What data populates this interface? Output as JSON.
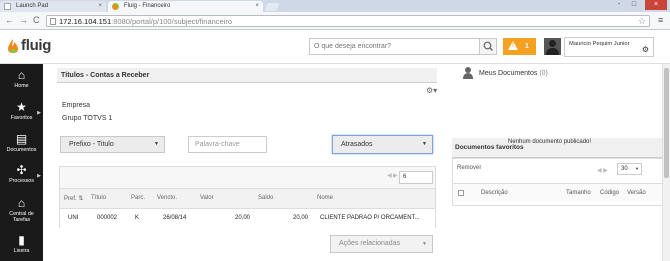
{
  "browser": {
    "tabs": [
      {
        "title": "Launch Pad",
        "close": "×"
      },
      {
        "title": "Fluig - Financeiro",
        "close": "×"
      }
    ],
    "nav": {
      "back": "←",
      "forward": "→",
      "reload": "C"
    },
    "url_host": "172.16.104.151",
    "url_path": ":8080/portal/p/100/subject/financeiro",
    "window_controls": {
      "minimize": "-",
      "maximize": "□",
      "close": "×"
    },
    "star": "☆",
    "menu": "≡"
  },
  "header": {
    "logo": "fluig",
    "search_placeholder": "O que deseja encontrar?",
    "notification_count": "1",
    "user_name": "Mauricio Pequim Junior",
    "settings_glyph": "⚙"
  },
  "sidebar": {
    "items": [
      {
        "label": "Home",
        "icon": "⌂",
        "arrow": ""
      },
      {
        "label": "Favoritos",
        "icon": "★",
        "arrow": "▶"
      },
      {
        "label": "Documentos",
        "icon": "▤",
        "arrow": ""
      },
      {
        "label": "Processos",
        "icon": "✣",
        "arrow": "▶"
      },
      {
        "label": "Central de Tarefas",
        "icon": "⌂",
        "arrow": ""
      },
      {
        "label": "Lixeira",
        "icon": "▮",
        "arrow": ""
      }
    ]
  },
  "panel": {
    "title": "Títulos - Contas a Receber",
    "gear": "⚙▾",
    "empresa_label": "Empresa",
    "grupo_label": "Grupo TOTVS 1",
    "prefixo_select": "Prefixo - Titulo",
    "keyword_placeholder": "Palavra-chave",
    "status_select": "Atrasados",
    "caret": "▼",
    "pager_prev": "◀",
    "pager_next": "▶",
    "page_size": "6",
    "columns": [
      "Pref. ⇅",
      "Título",
      "Parc.",
      "Vencto.",
      "Valor",
      "Saldo",
      "Nome"
    ],
    "rows": [
      {
        "pref": "UNI",
        "titulo": "000002",
        "parc": "K",
        "vencto": "26/08/14",
        "valor": "20,00",
        "saldo": "20,00",
        "nome": "CLIENTE PADRAO P/ ORCAMENT..."
      }
    ],
    "actions_select": "Ações relacionadas"
  },
  "right": {
    "meus_docs_label": "Meus Documentos",
    "meus_docs_count": "(0)",
    "fav_title": "Documentos favoritos",
    "fav_message": "Nenhum documento publicado!",
    "remover": "Remover",
    "fav_pager": "◀ ▶",
    "fav_page_size": "30",
    "fav_caret": "▼",
    "fav_columns": [
      "Descrição",
      "Tamanho",
      "Código",
      "Versão"
    ]
  }
}
